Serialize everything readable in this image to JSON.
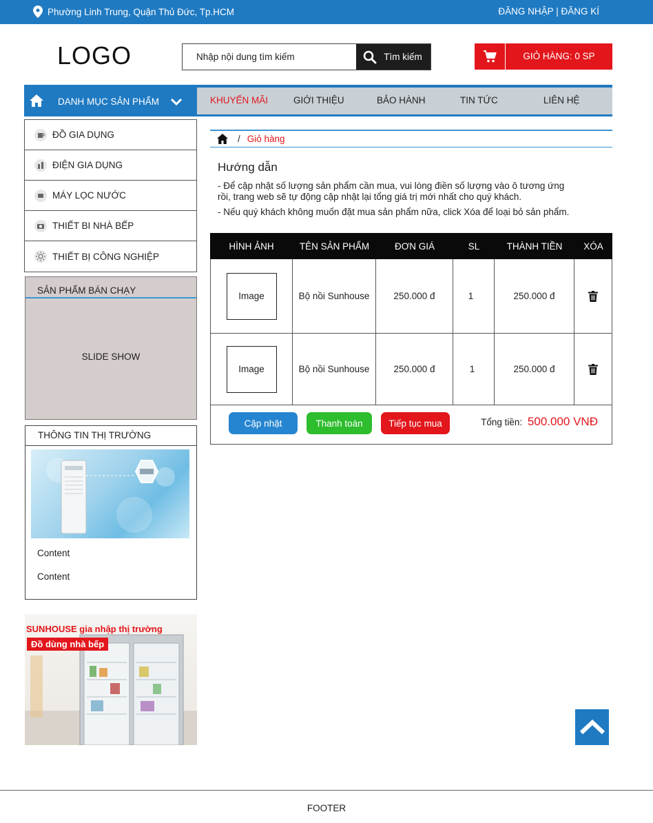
{
  "topbar": {
    "address": "Phường Linh Trung, Quận Thủ Đức, Tp.HCM",
    "login": "ĐĂNG NHẬP",
    "separator": "|",
    "register": "ĐĂNG KÍ",
    "color": "#1f7ac2"
  },
  "header": {
    "logo": "LOGO",
    "search_placeholder": "Nhập nội dung tìm kiếm",
    "search_button": "Tìm kiếm",
    "cart_label": "GIỎ HÀNG: 0 SP",
    "cart_color": "#e2161b"
  },
  "nav": {
    "category_label": "DANH MỤC SẢN PHẨM",
    "items": [
      "KHUYẾN MÃI",
      "GIỚI THIỆU",
      "BẢO HÀNH",
      "TIN TỨC",
      "LIÊN HỆ"
    ],
    "active_color": "#e2161b"
  },
  "sidebar": {
    "categories": [
      {
        "label": "ĐỒ GIA DỤNG",
        "icon": "kettle-icon"
      },
      {
        "label": "ĐIỆN GIA DỤNG",
        "icon": "appliance-icon"
      },
      {
        "label": "MÁY LỌC NƯỚC",
        "icon": "water-filter-icon"
      },
      {
        "label": "THIẾT BI NHÀ BẾP",
        "icon": "camera-icon"
      },
      {
        "label": "THIẾT  BỊ CÔNG NGHIỆP",
        "icon": "sun-icon"
      }
    ],
    "best_seller_title": "SẢN PHẨM BÁN CHẠY",
    "slideshow_label": "SLIDE SHOW",
    "market_title": "THÔNG TIN THỊ TRƯỜNG",
    "market_items": [
      "Content",
      "Content"
    ],
    "promo_line1": "SUNHOUSE gia nhập thị trường",
    "promo_line2": "Đồ dùng nhà bếp"
  },
  "breadcrumb": {
    "separator": "/",
    "current": "Giỏ hàng"
  },
  "guide": {
    "title": "Hướng dẫn",
    "line1": "- Để cập nhật số lượng sản phẩm cần mua, vui lòng điền số lượng vào ô tương ứng rồi, trang web sẽ tự động cập nhật lại tổng giá trị mới nhất cho quý khách.",
    "line2": "- Nếu quý khách không muốn đặt mua sản phẩm nữa, click Xóa để loại bỏ sản phẩm."
  },
  "cart_table": {
    "headers": [
      "HÌNH ẢNH",
      "TÊN SẢN PHẨM",
      "ĐƠN GIÁ",
      "SL",
      "THÀNH TIỀN",
      "XÓA"
    ],
    "rows": [
      {
        "image": "Image",
        "name": "Bộ nồi Sunhouse",
        "price": "250.000 đ",
        "qty": "1",
        "subtotal": "250.000 đ"
      },
      {
        "image": "Image",
        "name": "Bộ nồi Sunhouse",
        "price": "250.000 đ",
        "qty": "1",
        "subtotal": "250.000 đ"
      }
    ],
    "buttons": {
      "update": "Cập nhật",
      "checkout": "Thanh toán",
      "continue": "Tiếp tục mua"
    },
    "total_label": "Tổng tiền:",
    "total_value": "500.000 VNĐ"
  },
  "footer": {
    "label": "FOOTER"
  }
}
